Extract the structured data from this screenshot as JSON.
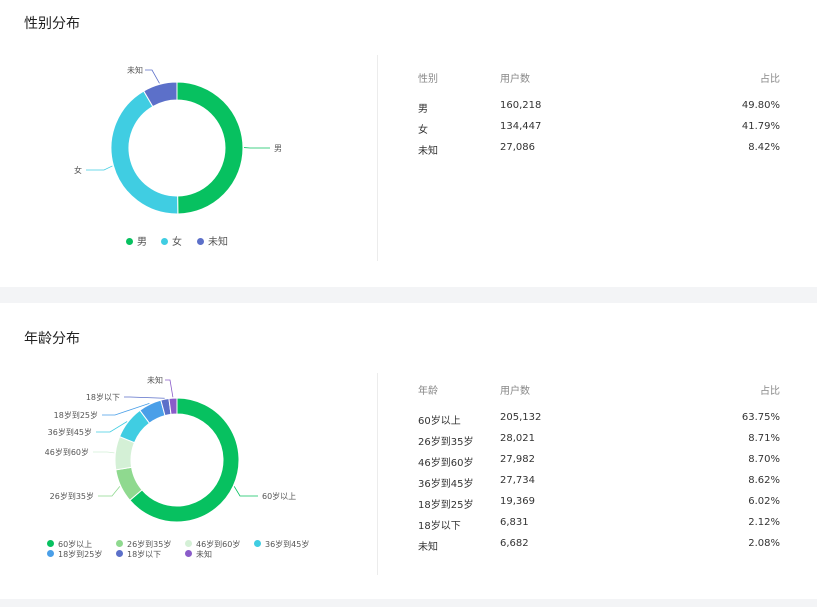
{
  "gender": {
    "title": "性别分布",
    "table": {
      "headers": [
        "性别",
        "用户数",
        "占比"
      ],
      "rows": [
        [
          "男",
          "160,218",
          "49.80%"
        ],
        [
          "女",
          "134,447",
          "41.79%"
        ],
        [
          "未知",
          "27,086",
          "8.42%"
        ]
      ]
    }
  },
  "age": {
    "title": "年龄分布",
    "table": {
      "headers": [
        "年龄",
        "用户数",
        "占比"
      ],
      "rows": [
        [
          "60岁以上",
          "205,132",
          "63.75%"
        ],
        [
          "26岁到35岁",
          "28,021",
          "8.71%"
        ],
        [
          "46岁到60岁",
          "27,982",
          "8.70%"
        ],
        [
          "36岁到45岁",
          "27,734",
          "8.62%"
        ],
        [
          "18岁到25岁",
          "19,369",
          "6.02%"
        ],
        [
          "18岁以下",
          "6,831",
          "2.12%"
        ],
        [
          "未知",
          "6,682",
          "2.08%"
        ]
      ]
    }
  },
  "chart_data": [
    {
      "type": "pie",
      "donut": true,
      "title": "性别分布",
      "categories": [
        "男",
        "女",
        "未知"
      ],
      "values": [
        160218,
        134447,
        27086
      ],
      "colors": [
        "#07c160",
        "#40cde2",
        "#5c70c9"
      ],
      "legend": "bottom"
    },
    {
      "type": "pie",
      "donut": true,
      "title": "年龄分布",
      "categories": [
        "60岁以上",
        "26岁到35岁",
        "46岁到60岁",
        "36岁到45岁",
        "18岁到25岁",
        "18岁以下",
        "未知"
      ],
      "values": [
        205132,
        28021,
        27982,
        27734,
        19369,
        6831,
        6682
      ],
      "colors": [
        "#07c160",
        "#8fd98f",
        "#d4f0d6",
        "#40cde2",
        "#4a9fe8",
        "#5c70c9",
        "#8a5cc9"
      ],
      "legend": "bottom"
    }
  ]
}
